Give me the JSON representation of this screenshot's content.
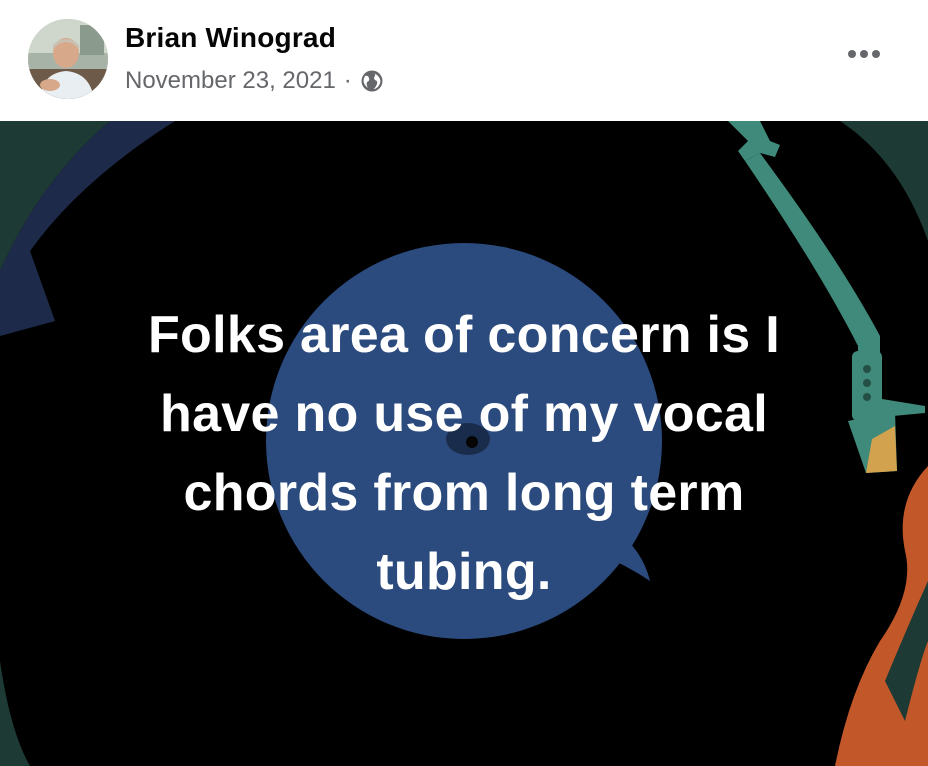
{
  "post": {
    "author": {
      "name": "Brian Winograd"
    },
    "date": "November 23, 2021",
    "separator": "·",
    "privacy_icon": "globe-icon",
    "more_icon": "ellipsis-icon",
    "text": "Folks area of concern is I have no use of my vocal chords from long term tubing.",
    "background": {
      "theme": "vinyl-record",
      "colors": {
        "base": "#000000",
        "record_label": "#2b4a7d",
        "top_left_shape": "#1d2a4a",
        "corner_green": "#1e3a34",
        "tonearm": "#3f8a7a",
        "cartridge": "#d2a24e",
        "orange_shape": "#c2582a"
      }
    }
  }
}
